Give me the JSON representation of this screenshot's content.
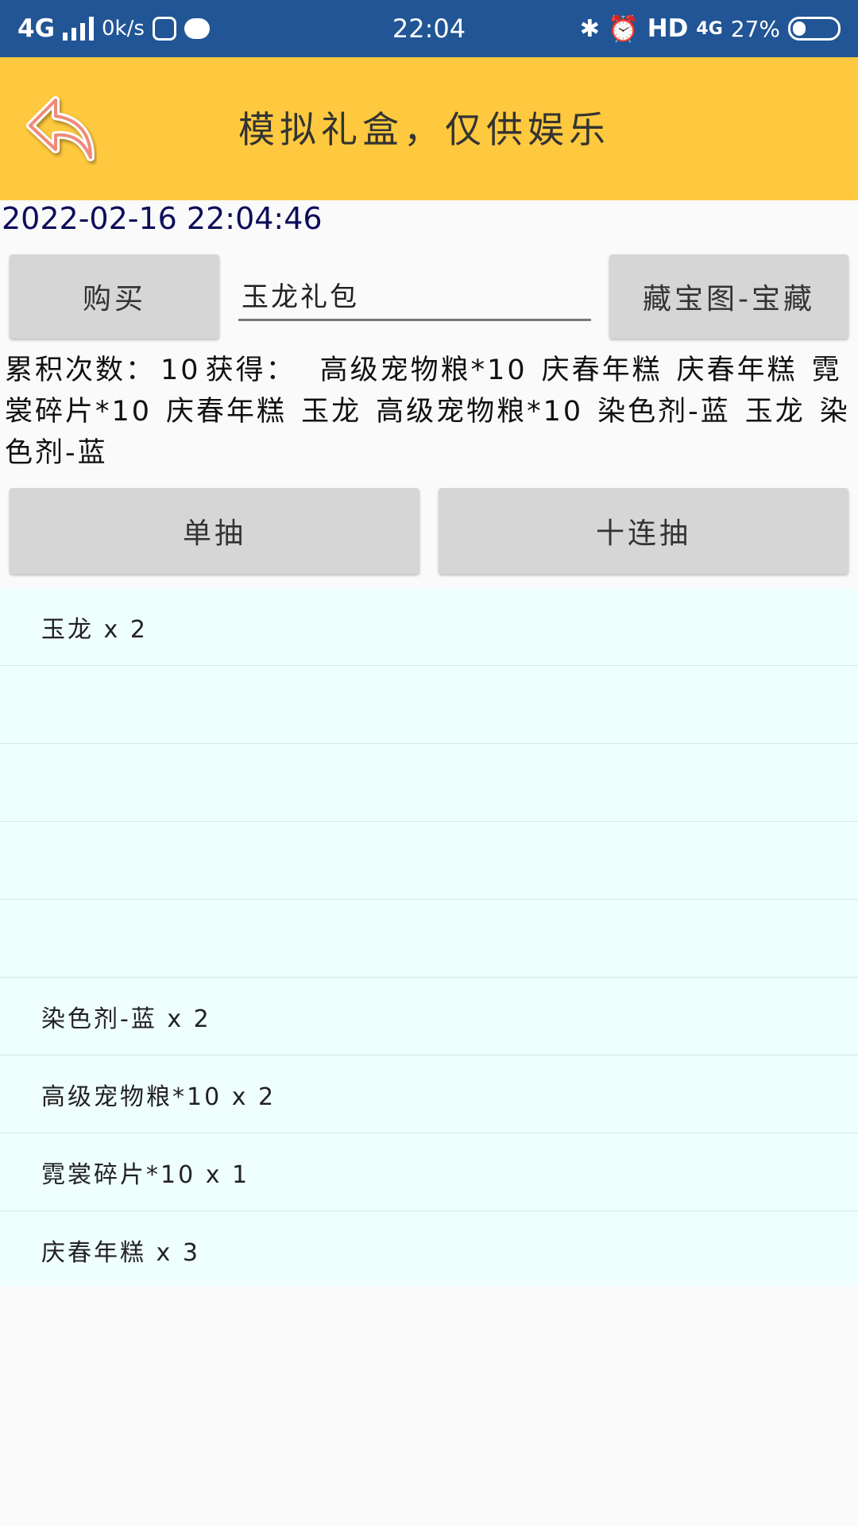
{
  "status_bar": {
    "network": "4G",
    "speed": "0k/s",
    "time": "22:04",
    "hd": "HD",
    "network_right": "4G",
    "battery": "27%"
  },
  "header": {
    "title": "模拟礼盒，仅供娱乐",
    "back_icon": "back-arrow-icon",
    "background_color": "#fec93e"
  },
  "datetime": "2022-02-16 22:04:46",
  "controls": {
    "buy_label": "购买",
    "gift_input_value": "玉龙礼包",
    "map_button_label": "藏宝图-宝藏"
  },
  "summary": {
    "count_label": "累积次数：",
    "count_value": "10",
    "obtained_label": "获得：",
    "items": [
      "高级宠物粮*10",
      "庆春年糕",
      "庆春年糕",
      "霓裳碎片*10",
      "庆春年糕",
      "玉龙",
      "高级宠物粮*10",
      "染色剂-蓝",
      "玉龙",
      "染色剂-蓝"
    ]
  },
  "draw": {
    "single_label": "单抽",
    "ten_label": "十连抽"
  },
  "results": [
    "玉龙 x 2",
    "",
    "",
    "",
    "",
    "染色剂-蓝 x 2",
    "高级宠物粮*10 x 2",
    "霓裳碎片*10 x 1",
    "庆春年糕 x 3"
  ],
  "colors": {
    "status_bar": "#215595",
    "list_background": "#effffe",
    "button": "#d6d6d6"
  }
}
